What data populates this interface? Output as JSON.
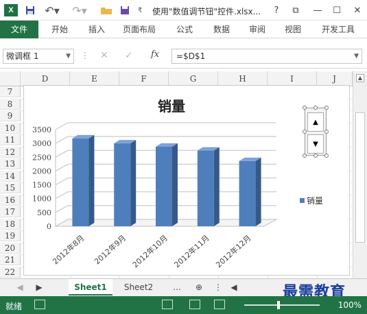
{
  "app": {
    "logo_letter": "X",
    "doc_title": "使用\"数值调节钮\"控件.xlsx...",
    "help": "?",
    "restore": "⧉",
    "minimize": "—",
    "maximize": "☐",
    "close": "✕"
  },
  "ribbon": {
    "tabs": [
      "文件",
      "开始",
      "插入",
      "页面布局",
      "公式",
      "数据",
      "审阅",
      "视图",
      "开发工具"
    ]
  },
  "formula_bar": {
    "name_box": "微调框 1",
    "formula": "=$D$1",
    "fx_label": "fx"
  },
  "sheet": {
    "columns": [
      "D",
      "E",
      "F",
      "G",
      "H",
      "I",
      "J"
    ],
    "rows": [
      "7",
      "8",
      "9",
      "10",
      "11",
      "12",
      "13",
      "14",
      "15",
      "16",
      "17",
      "18",
      "19",
      "20",
      "21",
      "22"
    ]
  },
  "chart_data": {
    "type": "bar",
    "title": "销量",
    "categories": [
      "2012年8月",
      "2012年9月",
      "2012年10月",
      "2012年11月",
      "2012年12月"
    ],
    "series": [
      {
        "name": "销量",
        "values": [
          3180,
          3000,
          2880,
          2740,
          2360
        ],
        "color": "#4f7ebd"
      }
    ],
    "ylim": [
      0,
      3500
    ],
    "yticks": [
      "0",
      "500",
      "1000",
      "1500",
      "2000",
      "2500",
      "3000",
      "3500"
    ],
    "legend": "right",
    "grid": true
  },
  "sheet_tabs": [
    "Sheet1",
    "Sheet2",
    "..."
  ],
  "status": {
    "ready": "就绪",
    "zoom": "100%"
  },
  "watermark": "最需教育"
}
